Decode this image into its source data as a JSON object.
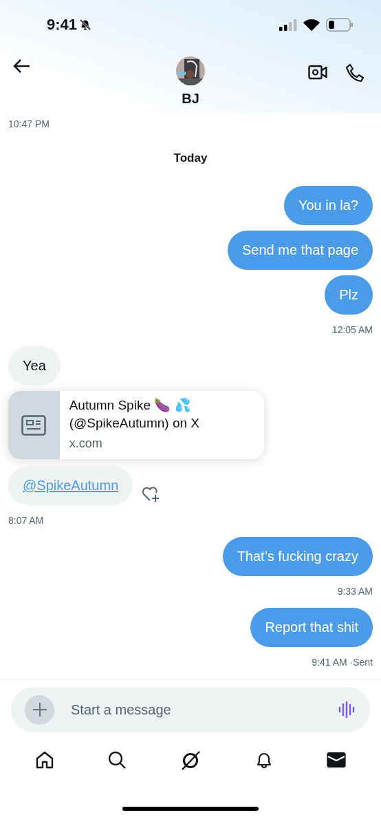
{
  "status_bar": {
    "time": "9:41"
  },
  "header": {
    "name": "BJ"
  },
  "earlier_time": "10:47 PM",
  "day_label": "Today",
  "messages": [
    {
      "kind": "text",
      "from_me": true,
      "text": "You in la?"
    },
    {
      "kind": "text",
      "from_me": true,
      "text": "Send me that page"
    },
    {
      "kind": "text",
      "from_me": true,
      "text": "Plz"
    },
    {
      "kind": "time",
      "from_me": true,
      "text": "12:05 AM"
    },
    {
      "kind": "text",
      "from_me": false,
      "text": "Yea"
    },
    {
      "kind": "link_card",
      "title": "Autumn Spike 🍆 💦 (@SpikeAutumn) on X",
      "domain": "x.com"
    },
    {
      "kind": "link",
      "from_me": false,
      "text": "@SpikeAutumn"
    },
    {
      "kind": "time",
      "from_me": false,
      "text": "8:07 AM"
    },
    {
      "kind": "text",
      "from_me": true,
      "text": "That’s fucking crazy"
    },
    {
      "kind": "time",
      "from_me": true,
      "text": "9:33 AM"
    },
    {
      "kind": "text",
      "from_me": true,
      "text": "Report that shit"
    },
    {
      "kind": "time",
      "from_me": true,
      "text": "9:41 AM",
      "status": "·Sent"
    }
  ],
  "composer": {
    "placeholder": "Start a message"
  },
  "nav": [
    {
      "kind": "home",
      "selected": false
    },
    {
      "kind": "search",
      "selected": false
    },
    {
      "kind": "grok",
      "selected": false
    },
    {
      "kind": "notifications",
      "selected": false
    },
    {
      "kind": "messages",
      "selected": true
    }
  ]
}
